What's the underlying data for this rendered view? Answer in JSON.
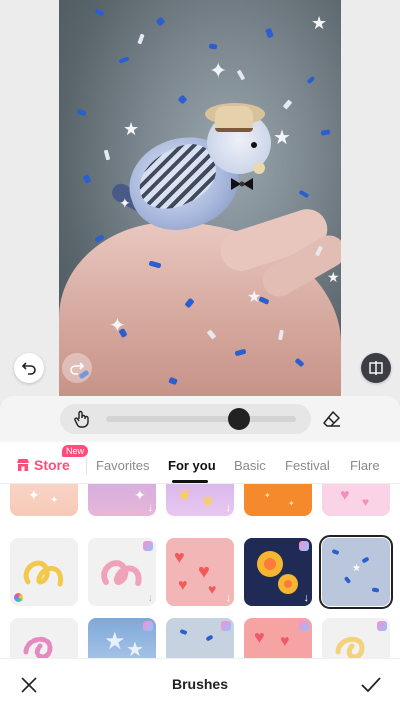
{
  "editor": {
    "undo_icon": "undo-arrow-icon",
    "redo_icon": "redo-arrow-icon",
    "compare_icon": "compare-icon"
  },
  "brush_panel": {
    "brush_size_percent": 70,
    "hand_icon": "hand-pointer-icon",
    "eraser_icon": "eraser-icon"
  },
  "tabs": {
    "store_label": "Store",
    "store_badge": "New",
    "items": [
      "Favorites",
      "For you",
      "Basic",
      "Festival",
      "Flare"
    ],
    "active": "For you"
  },
  "bottom_bar": {
    "title": "Brushes",
    "close_icon": "close-x-icon",
    "confirm_icon": "checkmark-icon"
  },
  "colors": {
    "accent_pink": "#ff4d7a",
    "active_tab": "#111111"
  }
}
